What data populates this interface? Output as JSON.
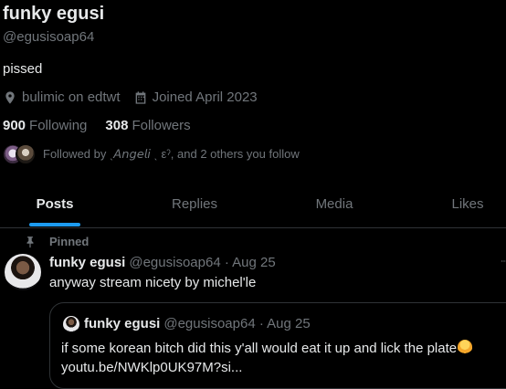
{
  "profile": {
    "display_name": "funky egusi",
    "handle": "@egusisoap64",
    "bio": "pissed",
    "location": "bulimic on edtwt",
    "location_icon": "location-pin-icon",
    "joined": "Joined April 2023",
    "joined_icon": "calendar-icon",
    "following_count": "900",
    "following_label": "Following",
    "followers_count": "308",
    "followers_label": "Followers",
    "followed_by_text": "Followed by ˎ𝘈𝘯𝘨𝘦𝘭𝘪 ˎ εˀ, and 2 others you follow"
  },
  "tabs": [
    {
      "label": "Posts",
      "active": true
    },
    {
      "label": "Replies",
      "active": false
    },
    {
      "label": "Media",
      "active": false
    },
    {
      "label": "Likes",
      "active": false
    }
  ],
  "pinned_post": {
    "pinned_label": "Pinned",
    "author_name": "funky egusi",
    "author_handle_time": "@egusisoap64 · Aug 25",
    "text": "anyway stream nicety by michel'le",
    "quote": {
      "author_name": "funky egusi",
      "author_handle_time": "@egusisoap64 · Aug 25",
      "line1": "if some korean bitch did this y'all would eat it up and lick the plate",
      "emoji": "person-gesturing-emoji",
      "line2": "youtu.be/NWKlp0UK97M?si..."
    }
  },
  "colors": {
    "background": "#000000",
    "text_primary": "#e7e9ea",
    "text_secondary": "#71767b",
    "accent": "#1d9bf0",
    "border": "#2f3336"
  }
}
